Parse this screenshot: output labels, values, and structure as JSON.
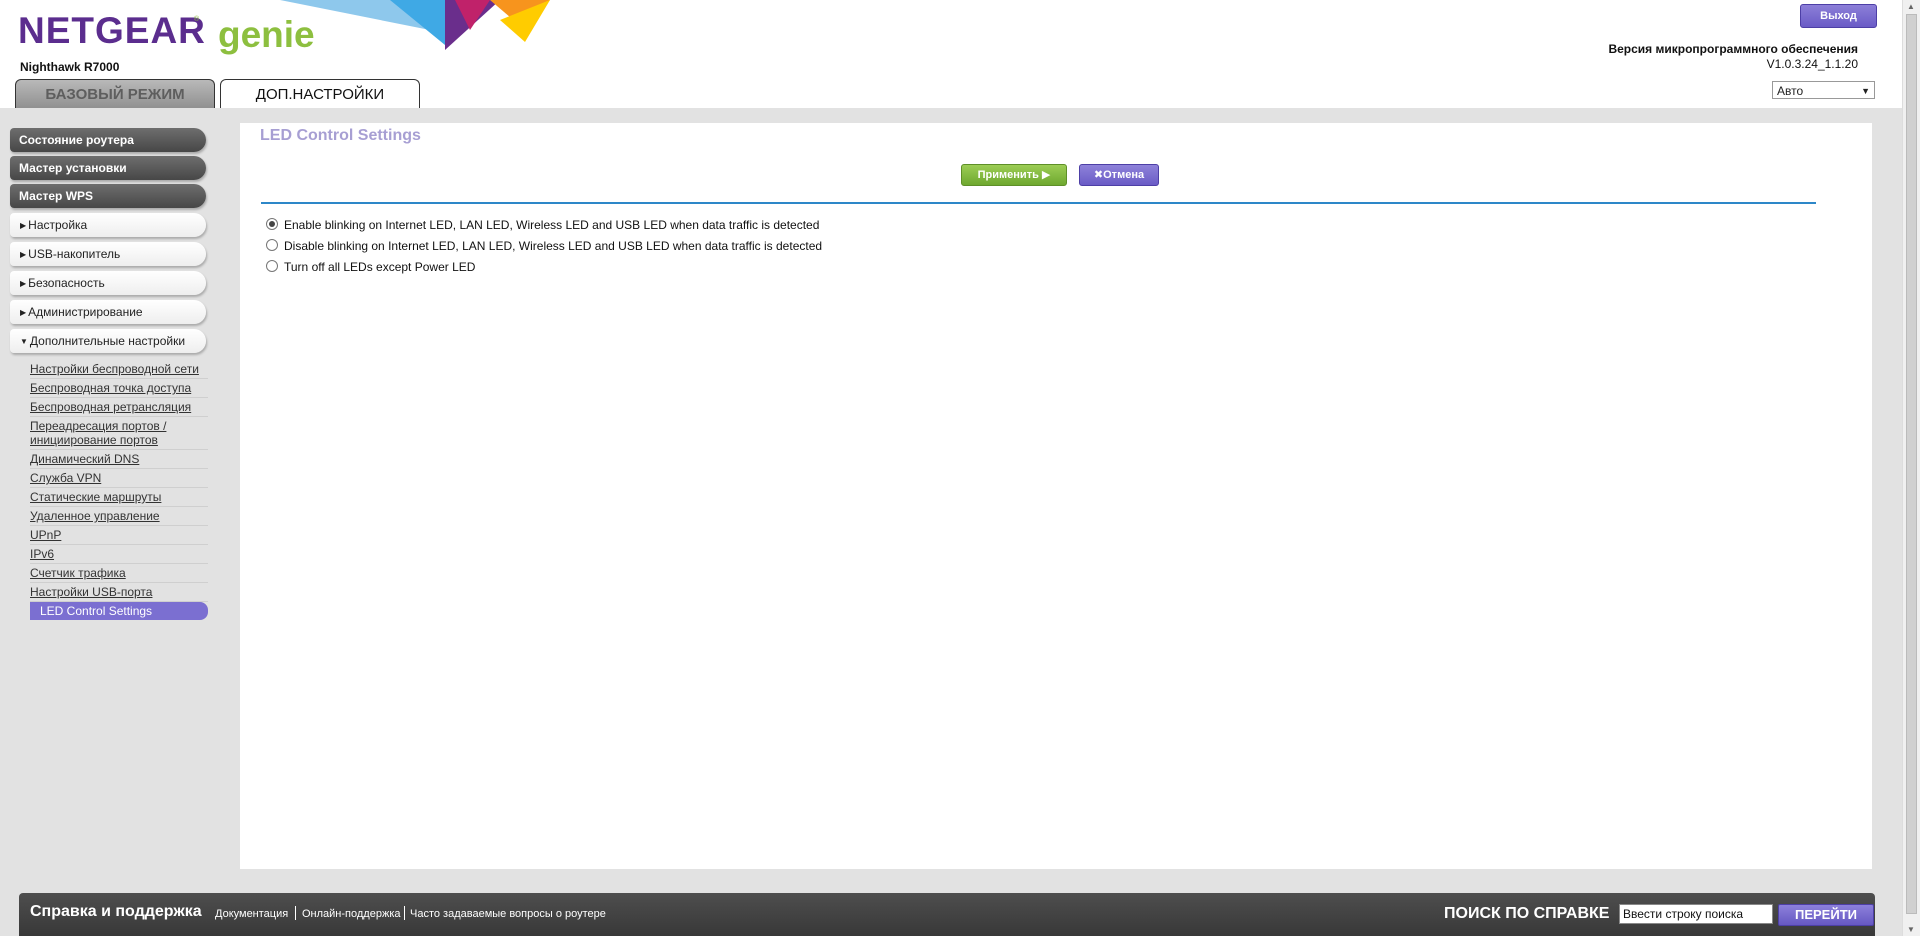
{
  "header": {
    "brand": "NETGEAR",
    "brand_mark": "®",
    "product": "genie",
    "model": "Nighthawk R7000",
    "logout_label": "Выход",
    "firmware_label": "Версия микропрограммного обеспечения",
    "firmware_version": "V1.0.3.24_1.1.20",
    "language_selected": "Авто",
    "tabs": [
      {
        "label": "БАЗОВЫЙ РЕЖИМ"
      },
      {
        "label": "ДОП.НАСТРОЙКИ"
      }
    ]
  },
  "sidebar": {
    "primary": [
      {
        "label": "Состояние роутера"
      },
      {
        "label": "Мастер установки"
      },
      {
        "label": "Мастер WPS"
      }
    ],
    "groups": [
      {
        "label": "Настройка",
        "caret": "▶"
      },
      {
        "label": "USB-накопитель",
        "caret": "▶"
      },
      {
        "label": "Безопасность",
        "caret": "▶"
      },
      {
        "label": "Администрирование",
        "caret": "▶"
      },
      {
        "label": "Дополнительные настройки",
        "caret": "▼"
      }
    ],
    "subitems": [
      {
        "label": "Настройки беспроводной сети"
      },
      {
        "label": "Беспроводная точка доступа"
      },
      {
        "label": "Беспроводная ретрансляция"
      },
      {
        "label": "Переадресация портов / инициирование портов"
      },
      {
        "label": "Динамический DNS"
      },
      {
        "label": "Служба VPN"
      },
      {
        "label": "Статические маршруты"
      },
      {
        "label": "Удаленное управление"
      },
      {
        "label": "UPnP"
      },
      {
        "label": "IPv6"
      },
      {
        "label": "Счетчик трафика"
      },
      {
        "label": "Настройки USB-порта"
      },
      {
        "label": "LED Control Settings"
      }
    ]
  },
  "content": {
    "title": "LED Control Settings",
    "apply_label": "Применить ▶",
    "cancel_label": "✖Отмена",
    "options": [
      {
        "label": "Enable blinking on Internet LED, LAN LED, Wireless LED and USB LED when data traffic is detected",
        "checked": true
      },
      {
        "label": "Disable blinking on Internet LED, LAN LED, Wireless LED and USB LED when data traffic is detected",
        "checked": false
      },
      {
        "label": "Turn off all LEDs except Power LED",
        "checked": false
      }
    ]
  },
  "footer": {
    "title": "Справка и поддержка",
    "links": [
      {
        "label": "Документация"
      },
      {
        "label": "Онлайн-поддержка"
      },
      {
        "label": "Часто задаваемые вопросы о роутере"
      }
    ],
    "search_label": "ПОИСК ПО СПРАВКЕ",
    "search_value": "Ввести строку поиска",
    "search_button": "ПЕРЕЙТИ"
  },
  "colors": {
    "brand_purple": "#5b2d8e",
    "genie_green": "#8dbf3f",
    "accent_purple": "#7b6fd1",
    "apply_green": "#7fb83e",
    "divider_blue": "#2d87c8"
  }
}
